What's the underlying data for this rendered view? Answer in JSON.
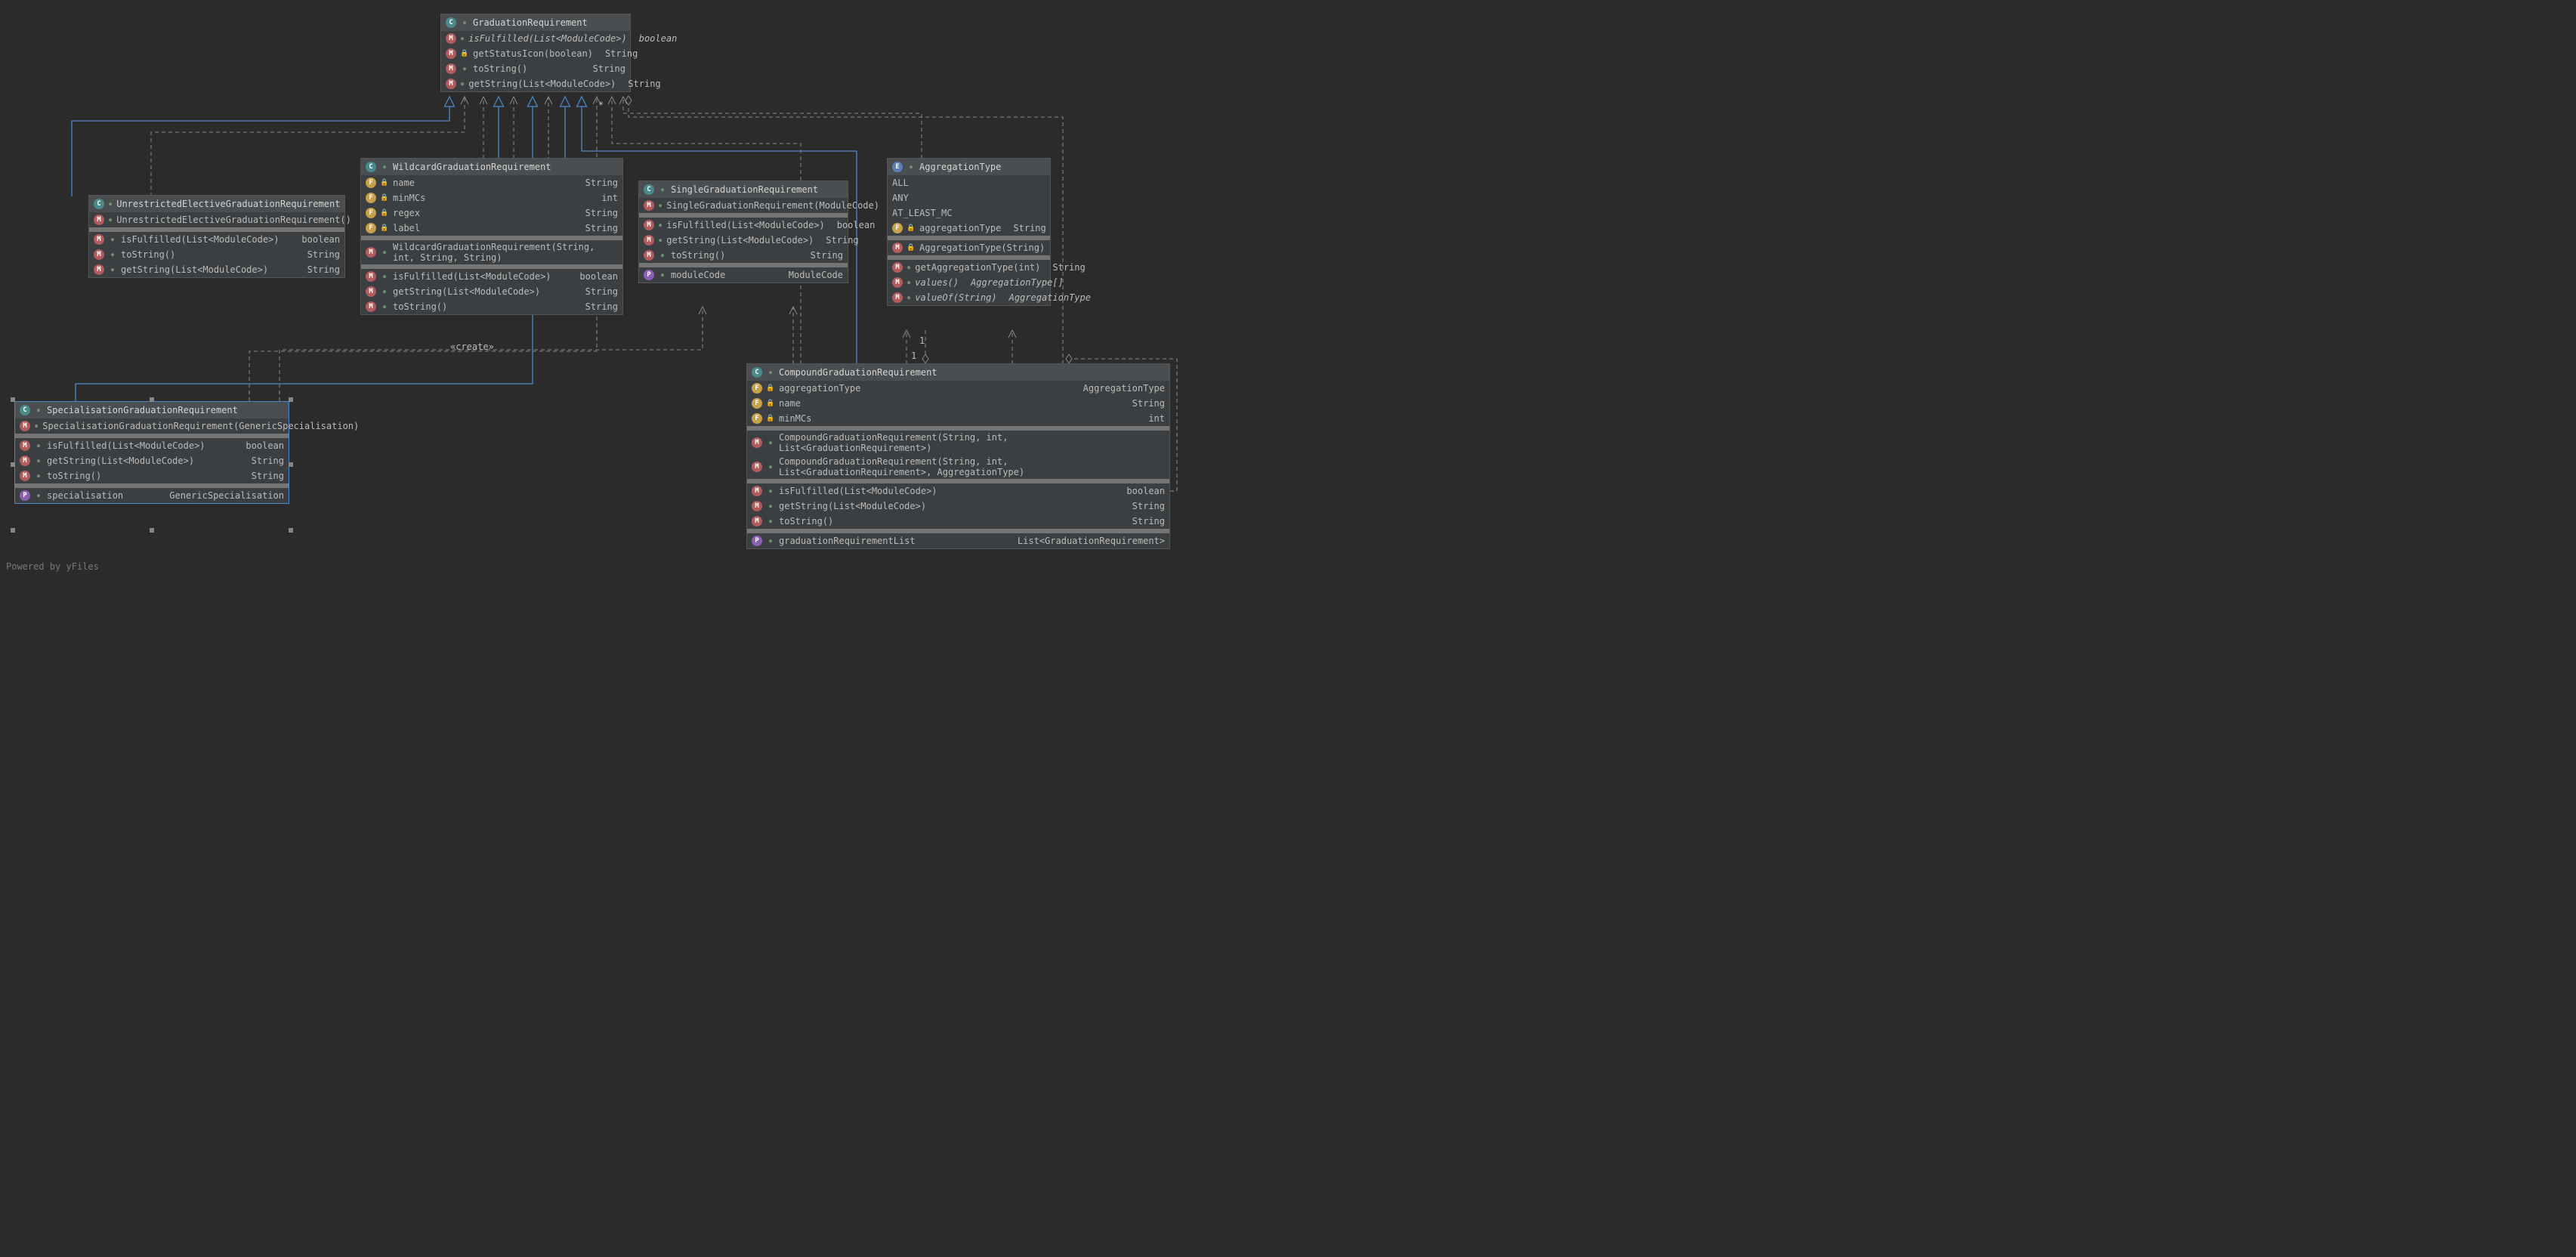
{
  "footer": "Powered by yFiles",
  "createLabel": "«create»",
  "multStar": "*",
  "multOne1": "1",
  "multOne2": "1",
  "classes": {
    "graduationRequirement": {
      "name": "GraduationRequirement",
      "kind": "class",
      "rows": [
        {
          "icon": "m",
          "vis": "pub",
          "sig": "isFulfilled(List<ModuleCode>)",
          "ret": "boolean",
          "italic": true
        },
        {
          "icon": "m",
          "vis": "priv",
          "sig": "getStatusIcon(boolean)",
          "ret": "String"
        },
        {
          "icon": "m",
          "vis": "pub",
          "sig": "toString()",
          "ret": "String"
        },
        {
          "icon": "m",
          "vis": "pub",
          "sig": "getString(List<ModuleCode>)",
          "ret": "String"
        }
      ]
    },
    "unrestricted": {
      "name": "UnrestrictedElectiveGraduationRequirement",
      "kind": "class",
      "ctors": [
        {
          "icon": "m",
          "vis": "pub",
          "sig": "UnrestrictedElectiveGraduationRequirement()"
        }
      ],
      "rows": [
        {
          "icon": "m",
          "vis": "pub",
          "sig": "isFulfilled(List<ModuleCode>)",
          "ret": "boolean"
        },
        {
          "icon": "m",
          "vis": "pub",
          "sig": "toString()",
          "ret": "String"
        },
        {
          "icon": "m",
          "vis": "pub",
          "sig": "getString(List<ModuleCode>)",
          "ret": "String"
        }
      ]
    },
    "wildcard": {
      "name": "WildcardGraduationRequirement",
      "kind": "class",
      "fields": [
        {
          "icon": "f",
          "vis": "priv",
          "sig": "name",
          "ret": "String"
        },
        {
          "icon": "f",
          "vis": "priv",
          "sig": "minMCs",
          "ret": "int"
        },
        {
          "icon": "f",
          "vis": "priv",
          "sig": "regex",
          "ret": "String"
        },
        {
          "icon": "f",
          "vis": "priv",
          "sig": "label",
          "ret": "String"
        }
      ],
      "ctors": [
        {
          "icon": "m",
          "vis": "pub",
          "sig": "WildcardGraduationRequirement(String, int, String, String)"
        }
      ],
      "rows": [
        {
          "icon": "m",
          "vis": "pub",
          "sig": "isFulfilled(List<ModuleCode>)",
          "ret": "boolean"
        },
        {
          "icon": "m",
          "vis": "pub",
          "sig": "getString(List<ModuleCode>)",
          "ret": "String"
        },
        {
          "icon": "m",
          "vis": "pub",
          "sig": "toString()",
          "ret": "String"
        }
      ]
    },
    "single": {
      "name": "SingleGraduationRequirement",
      "kind": "class",
      "ctors": [
        {
          "icon": "m",
          "vis": "pub",
          "sig": "SingleGraduationRequirement(ModuleCode)"
        }
      ],
      "rows": [
        {
          "icon": "m",
          "vis": "pub",
          "sig": "isFulfilled(List<ModuleCode>)",
          "ret": "boolean"
        },
        {
          "icon": "m",
          "vis": "pub",
          "sig": "getString(List<ModuleCode>)",
          "ret": "String"
        },
        {
          "icon": "m",
          "vis": "pub",
          "sig": "toString()",
          "ret": "String"
        }
      ],
      "props": [
        {
          "icon": "p",
          "vis": "pub",
          "sig": "moduleCode",
          "ret": "ModuleCode"
        }
      ]
    },
    "aggregationType": {
      "name": "AggregationType",
      "kind": "enum",
      "consts": [
        {
          "sig": "ALL"
        },
        {
          "sig": "ANY"
        },
        {
          "sig": "AT_LEAST_MC"
        }
      ],
      "fields": [
        {
          "icon": "f",
          "vis": "priv",
          "sig": "aggregationType",
          "ret": "String"
        }
      ],
      "ctors": [
        {
          "icon": "m",
          "vis": "priv",
          "sig": "AggregationType(String)"
        }
      ],
      "rows": [
        {
          "icon": "m",
          "vis": "pub",
          "sig": "getAggregationType(int)",
          "ret": "String"
        },
        {
          "icon": "m",
          "vis": "pub",
          "sig": "values()",
          "ret": "AggregationType[]",
          "italic": true
        },
        {
          "icon": "m",
          "vis": "pub",
          "sig": "valueOf(String)",
          "ret": "AggregationType",
          "italic": true
        }
      ]
    },
    "specialisation": {
      "name": "SpecialisationGraduationRequirement",
      "kind": "class",
      "ctors": [
        {
          "icon": "m",
          "vis": "pub",
          "sig": "SpecialisationGraduationRequirement(GenericSpecialisation)"
        }
      ],
      "rows": [
        {
          "icon": "m",
          "vis": "pub",
          "sig": "isFulfilled(List<ModuleCode>)",
          "ret": "boolean"
        },
        {
          "icon": "m",
          "vis": "pub",
          "sig": "getString(List<ModuleCode>)",
          "ret": "String"
        },
        {
          "icon": "m",
          "vis": "pub",
          "sig": "toString()",
          "ret": "String"
        }
      ],
      "props": [
        {
          "icon": "p",
          "vis": "pub",
          "sig": "specialisation",
          "ret": "GenericSpecialisation"
        }
      ]
    },
    "compound": {
      "name": "CompoundGraduationRequirement",
      "kind": "class",
      "fields": [
        {
          "icon": "f",
          "vis": "priv",
          "sig": "aggregationType",
          "ret": "AggregationType"
        },
        {
          "icon": "f",
          "vis": "priv",
          "sig": "name",
          "ret": "String"
        },
        {
          "icon": "f",
          "vis": "priv",
          "sig": "minMCs",
          "ret": "int"
        }
      ],
      "ctors": [
        {
          "icon": "m",
          "vis": "pub",
          "sig": "CompoundGraduationRequirement(String, int, List<GraduationRequirement>)"
        },
        {
          "icon": "m",
          "vis": "pub",
          "sig": "CompoundGraduationRequirement(String, int, List<GraduationRequirement>, AggregationType)"
        }
      ],
      "rows": [
        {
          "icon": "m",
          "vis": "pub",
          "sig": "isFulfilled(List<ModuleCode>)",
          "ret": "boolean"
        },
        {
          "icon": "m",
          "vis": "pub",
          "sig": "getString(List<ModuleCode>)",
          "ret": "String"
        },
        {
          "icon": "m",
          "vis": "pub",
          "sig": "toString()",
          "ret": "String"
        }
      ],
      "props": [
        {
          "icon": "p",
          "vis": "pub",
          "sig": "graduationRequirementList",
          "ret": "List<GraduationRequirement>"
        }
      ]
    }
  }
}
